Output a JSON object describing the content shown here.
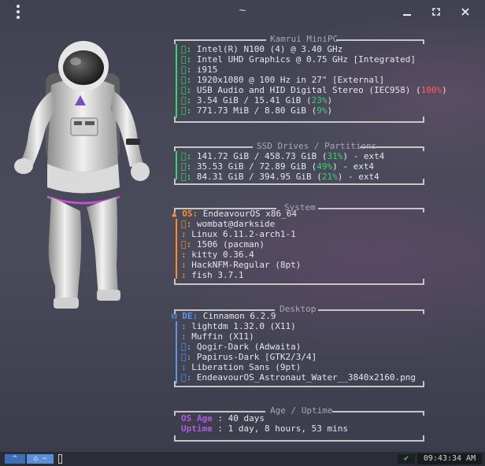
{
  "window": {
    "title": "~"
  },
  "sections": {
    "hardware": {
      "header": "Kamrui MiniPC",
      "rows": [
        {
          "icon": "󰍛:",
          "value": "Intel(R) N100 (4) @ 3.40 GHz"
        },
        {
          "icon": "󰍹:",
          "value": "Intel UHD Graphics @ 0.75 GHz [Integrated]"
        },
        {
          "icon": "󰾲:",
          "value": "i915"
        },
        {
          "icon": "󰍹:",
          "value": "1920x1080 @ 100 Hz in 27\" [External]"
        },
        {
          "icon": "󰓃:",
          "value": "USB Audio and HID Digital Stereo (IEC958) (",
          "pct": "100%",
          "tail": ")"
        },
        {
          "icon": "󰑭:",
          "value": "3.54 GiB / 15.41 GiB (",
          "pct": "23%",
          "tail": ")"
        },
        {
          "icon": "󰾴:",
          "value": "771.73 MiB / 8.80 GiB (",
          "pct": "9%",
          "tail": ")"
        }
      ]
    },
    "drives": {
      "header": "SSD Drives / Partitions",
      "rows": [
        {
          "icon": "󰋊:",
          "value": "141.72 GiB / 458.73 GiB (",
          "pct": "31%",
          "tail": ") - ext4"
        },
        {
          "icon": "󰋊:",
          "value": "35.53 GiB / 72.89 GiB (",
          "pct": "49%",
          "tail": ") - ext4"
        },
        {
          "icon": "󰋊:",
          "value": "84.31 GiB / 394.95 GiB (",
          "pct": "21%",
          "tail": ") - ext4"
        }
      ]
    },
    "system": {
      "header": "System",
      "os_key": "OS:",
      "os_value": "EndeavourOS x86_64",
      "rows": [
        {
          "icon": "󰀄:",
          "value": "wombat@darkside"
        },
        {
          "icon": ":",
          "value": "Linux 6.11.2-arch1-1"
        },
        {
          "icon": "󰏖:",
          "value": "1506 (pacman)"
        },
        {
          "icon": ":",
          "value": "kitty 0.36.4"
        },
        {
          "icon": ":",
          "value": "HackNFM-Regular (8pt)"
        },
        {
          "icon": ":",
          "value": "fish 3.7.1"
        }
      ]
    },
    "desktop": {
      "header": "Desktop",
      "de_key": "DE:",
      "de_value": "Cinnamon 6.2.9",
      "rows": [
        {
          "icon": ":",
          "value": "lightdm 1.32.0 (X11)"
        },
        {
          "icon": ":",
          "value": "Muffin (X11)"
        },
        {
          "icon": "󰉼:",
          "value": "Qogir-Dark (Adwaita)"
        },
        {
          "icon": "󰉼:",
          "value": "Papirus-Dark [GTK2/3/4]"
        },
        {
          "icon": ":",
          "value": "Liberation Sans (9pt)"
        },
        {
          "icon": "󰸉:",
          "value": "EndeavourOS_Astronaut_Water__3840x2160.png"
        }
      ]
    },
    "age": {
      "header": "Age / Uptime",
      "os_age_key": "OS Age",
      "os_age_value": " : 40 days",
      "uptime_key": "Uptime",
      "uptime_value": " : 1 day, 8 hours, 53 mins"
    }
  },
  "taskbar": {
    "tab1": "^",
    "tab2": "~",
    "status": "✔",
    "clock": "09:43:34 AM"
  },
  "colors": {
    "green": "#38d66b",
    "orange": "#ff8c28",
    "blue": "#5a97ea",
    "purple": "#b05ce0",
    "red": "#ff5f6b"
  }
}
